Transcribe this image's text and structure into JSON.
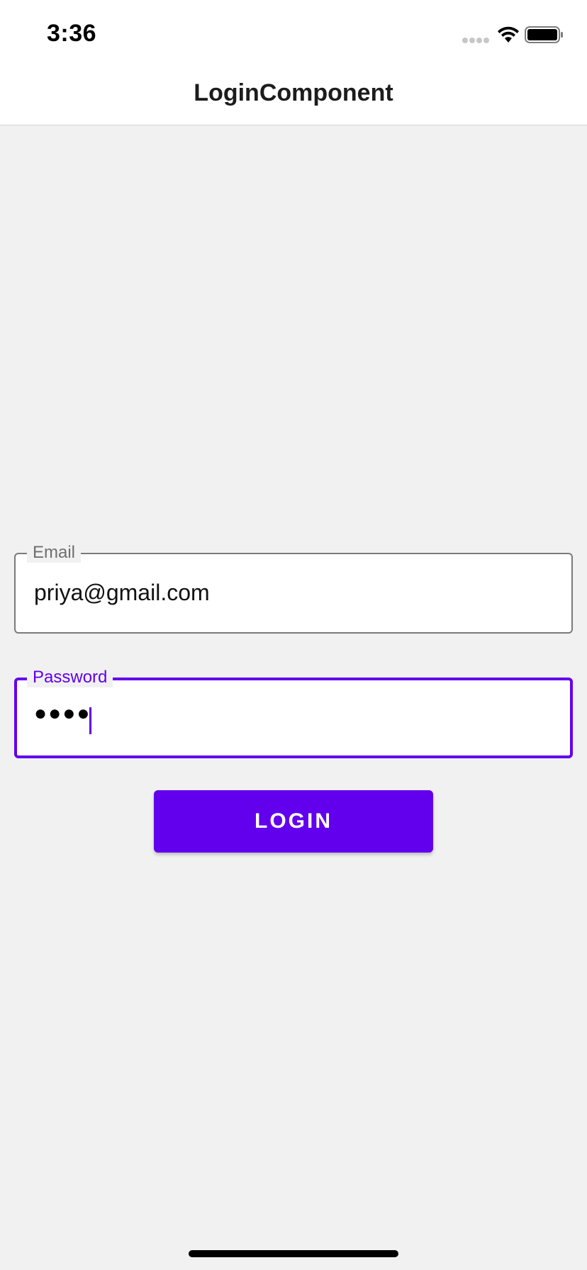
{
  "status_bar": {
    "time": "3:36",
    "icons": [
      "signal-dots-icon",
      "wifi-icon",
      "battery-icon"
    ]
  },
  "nav": {
    "title": "LoginComponent"
  },
  "form": {
    "email": {
      "label": "Email",
      "value": "priya@gmail.com"
    },
    "password": {
      "label": "Password",
      "value_masked": "●●●●",
      "focused": true
    },
    "login_button_label": "LOGIN"
  },
  "colors": {
    "accent": "#6200ee",
    "background": "#f1f1f1",
    "surface": "#ffffff",
    "outline": "#7a7a7a"
  }
}
